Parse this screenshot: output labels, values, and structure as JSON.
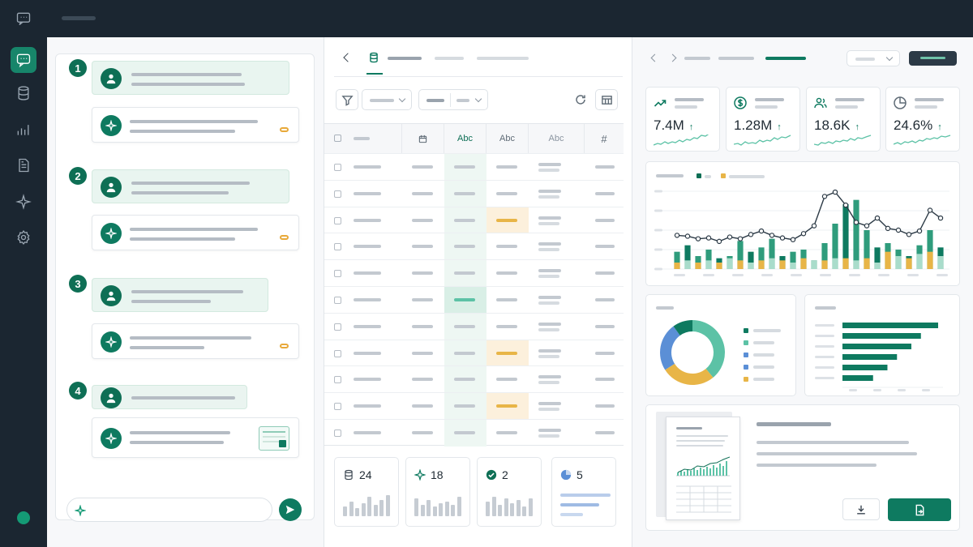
{
  "kpis": [
    {
      "icon": "trend-up-icon",
      "value": "7.4M",
      "arrow": "↑"
    },
    {
      "icon": "dollar-icon",
      "value": "1.28M",
      "arrow": "↑"
    },
    {
      "icon": "users-icon",
      "value": "18.6K",
      "arrow": "↑"
    },
    {
      "icon": "pie-icon",
      "value": "24.6%",
      "arrow": "↑"
    }
  ],
  "grid": {
    "headers": [
      "Abc",
      "Abc",
      "Abc",
      "#"
    ],
    "rows": 11
  },
  "stats": [
    {
      "icon": "database-icon",
      "value": "24"
    },
    {
      "icon": "sparkle-icon",
      "value": "18"
    },
    {
      "icon": "check-circle-icon",
      "value": "2"
    },
    {
      "icon": "pie-icon",
      "value": "5"
    }
  ],
  "chat": {
    "steps": [
      "1",
      "2",
      "3",
      "4"
    ]
  },
  "colors": {
    "primary": "#0e7a60",
    "teal": "#5cc2a6",
    "amber": "#e8b547",
    "blue": "#5b8fd6",
    "dark": "#1b2631"
  },
  "chart_data": [
    {
      "type": "bar",
      "series": [
        {
          "values": [
            40,
            55,
            30,
            45,
            25,
            30,
            65,
            40,
            50,
            70,
            30,
            40,
            45,
            20,
            60,
            105,
            150,
            160,
            90,
            50,
            60,
            45,
            30,
            55,
            90,
            50
          ]
        },
        {
          "values": [
            15,
            20,
            15,
            20,
            15,
            25,
            20,
            15,
            20,
            25,
            20,
            15,
            25,
            20,
            20,
            25,
            25,
            20,
            25,
            15,
            40,
            30,
            25,
            35,
            40,
            30
          ]
        },
        {
          "type": "line",
          "values": [
            78,
            76,
            70,
            72,
            64,
            74,
            70,
            80,
            88,
            78,
            72,
            68,
            82,
            100,
            168,
            178,
            148,
            108,
            100,
            118,
            94,
            90,
            80,
            88,
            136,
            118
          ]
        }
      ]
    },
    {
      "type": "pie",
      "values": [
        0.39,
        0.27,
        0.24,
        0.1
      ],
      "colors": [
        "#5cc2a6",
        "#e8b547",
        "#5b8fd6",
        "#0e7a60"
      ]
    },
    {
      "type": "bar",
      "orientation": "horizontal",
      "values": [
        100,
        82,
        72,
        57,
        47,
        32
      ]
    }
  ]
}
